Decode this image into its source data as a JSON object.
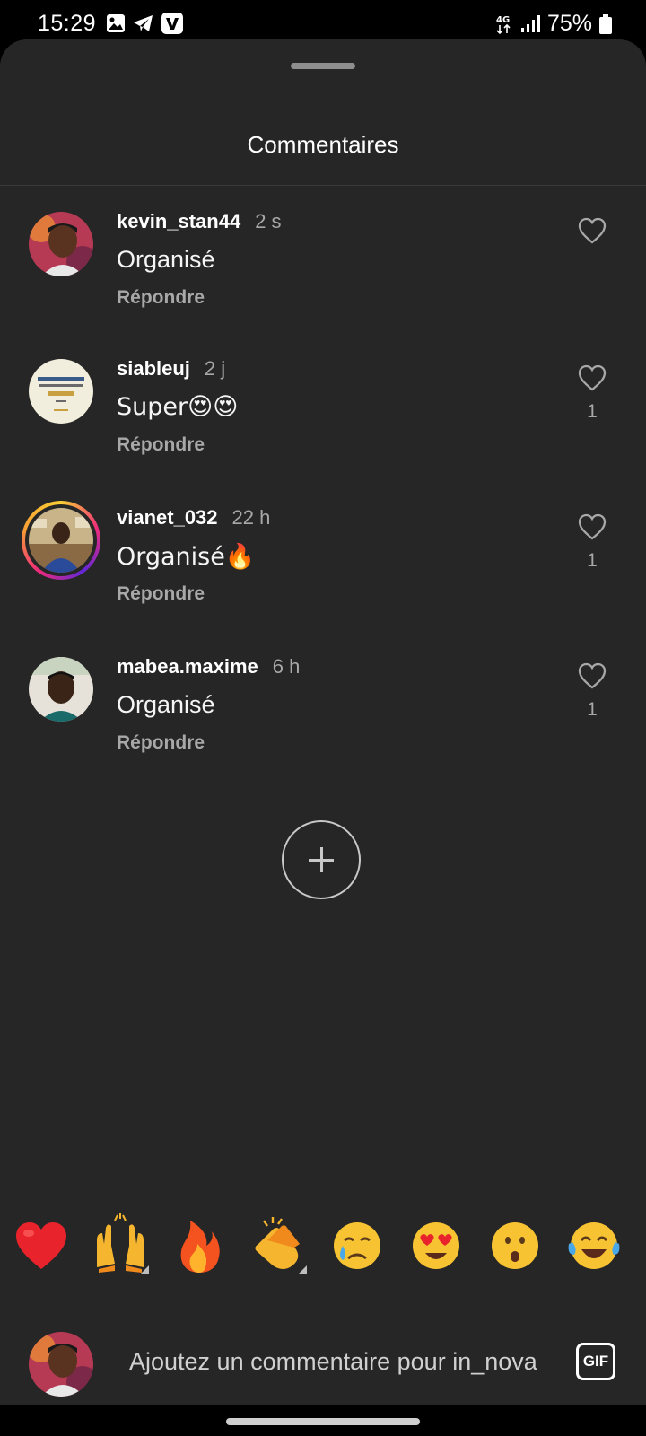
{
  "status_bar": {
    "time": "15:29",
    "network": "4G",
    "battery": "75%",
    "icons": [
      "gallery-icon",
      "telegram-icon",
      "vivid-app-icon",
      "signal-icon",
      "battery-icon"
    ]
  },
  "sheet": {
    "title": "Commentaires"
  },
  "comments": [
    {
      "username": "kevin_stan44",
      "time": "2 s",
      "text": "Organisé",
      "reply": "Répondre",
      "likes": ""
    },
    {
      "username": "siableuj",
      "time": "2 j",
      "text": "Super😍😍",
      "reply": "Répondre",
      "likes": "1"
    },
    {
      "username": "vianet_032",
      "time": "22 h",
      "text": "Organisé🔥",
      "reply": "Répondre",
      "likes": "1"
    },
    {
      "username": "mabea.maxime",
      "time": "6 h",
      "text": "Organisé",
      "reply": "Répondre",
      "likes": "1"
    }
  ],
  "quick_reactions": [
    "❤️",
    "🙌",
    "🔥",
    "👏",
    "😢",
    "😍",
    "😮",
    "😂"
  ],
  "composer": {
    "placeholder": "Ajoutez un commentaire pour in_nova",
    "gif_label": "GIF"
  },
  "colors": {
    "sheet_bg": "#262626",
    "secondary_text": "#a8a8a8",
    "story_ring": "#ee2a7b"
  }
}
